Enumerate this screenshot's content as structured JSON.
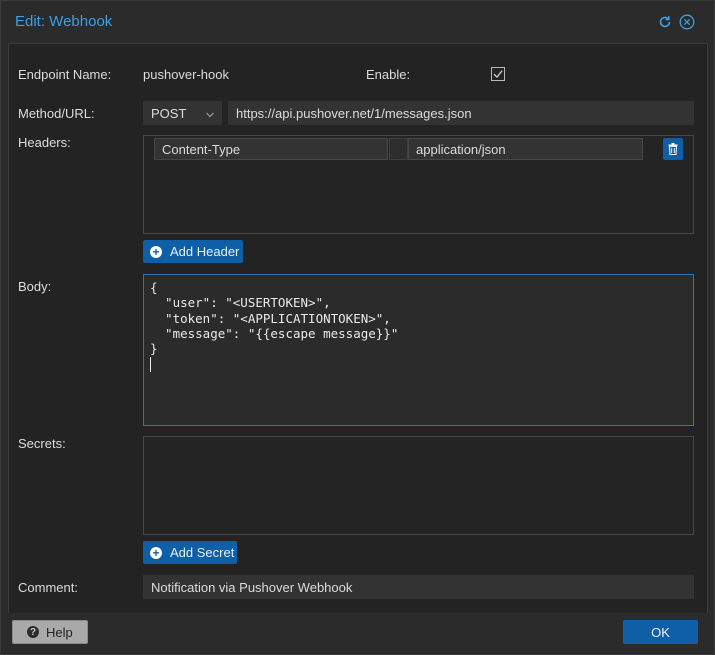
{
  "dialog": {
    "title": "Edit: Webhook"
  },
  "form": {
    "endpoint_label": "Endpoint Name:",
    "endpoint_value": "pushover-hook",
    "enable_label": "Enable:",
    "enable_checked": true,
    "method_label": "Method/URL:",
    "method_value": "POST",
    "url_value": "https://api.pushover.net/1/messages.json",
    "headers_label": "Headers:",
    "headers": [
      {
        "key": "Content-Type",
        "value": "application/json"
      }
    ],
    "add_header_label": "Add Header",
    "body_label": "Body:",
    "body_text": "{\n  \"user\": \"<USERTOKEN>\",\n  \"token\": \"<APPLICATIONTOKEN>\",\n  \"message\": \"{{escape message}}\"\n}\n",
    "secrets_label": "Secrets:",
    "add_secret_label": "Add Secret",
    "comment_label": "Comment:",
    "comment_value": "Notification via Pushover Webhook"
  },
  "footer": {
    "help_label": "Help",
    "ok_label": "OK"
  },
  "colors": {
    "accent": "#3c9fe6",
    "button": "#0f5ea8"
  },
  "icons": [
    "reset-icon",
    "close-icon",
    "checkbox-icon",
    "chevron-down-icon",
    "trash-icon",
    "plus-circle-icon",
    "help-icon"
  ]
}
